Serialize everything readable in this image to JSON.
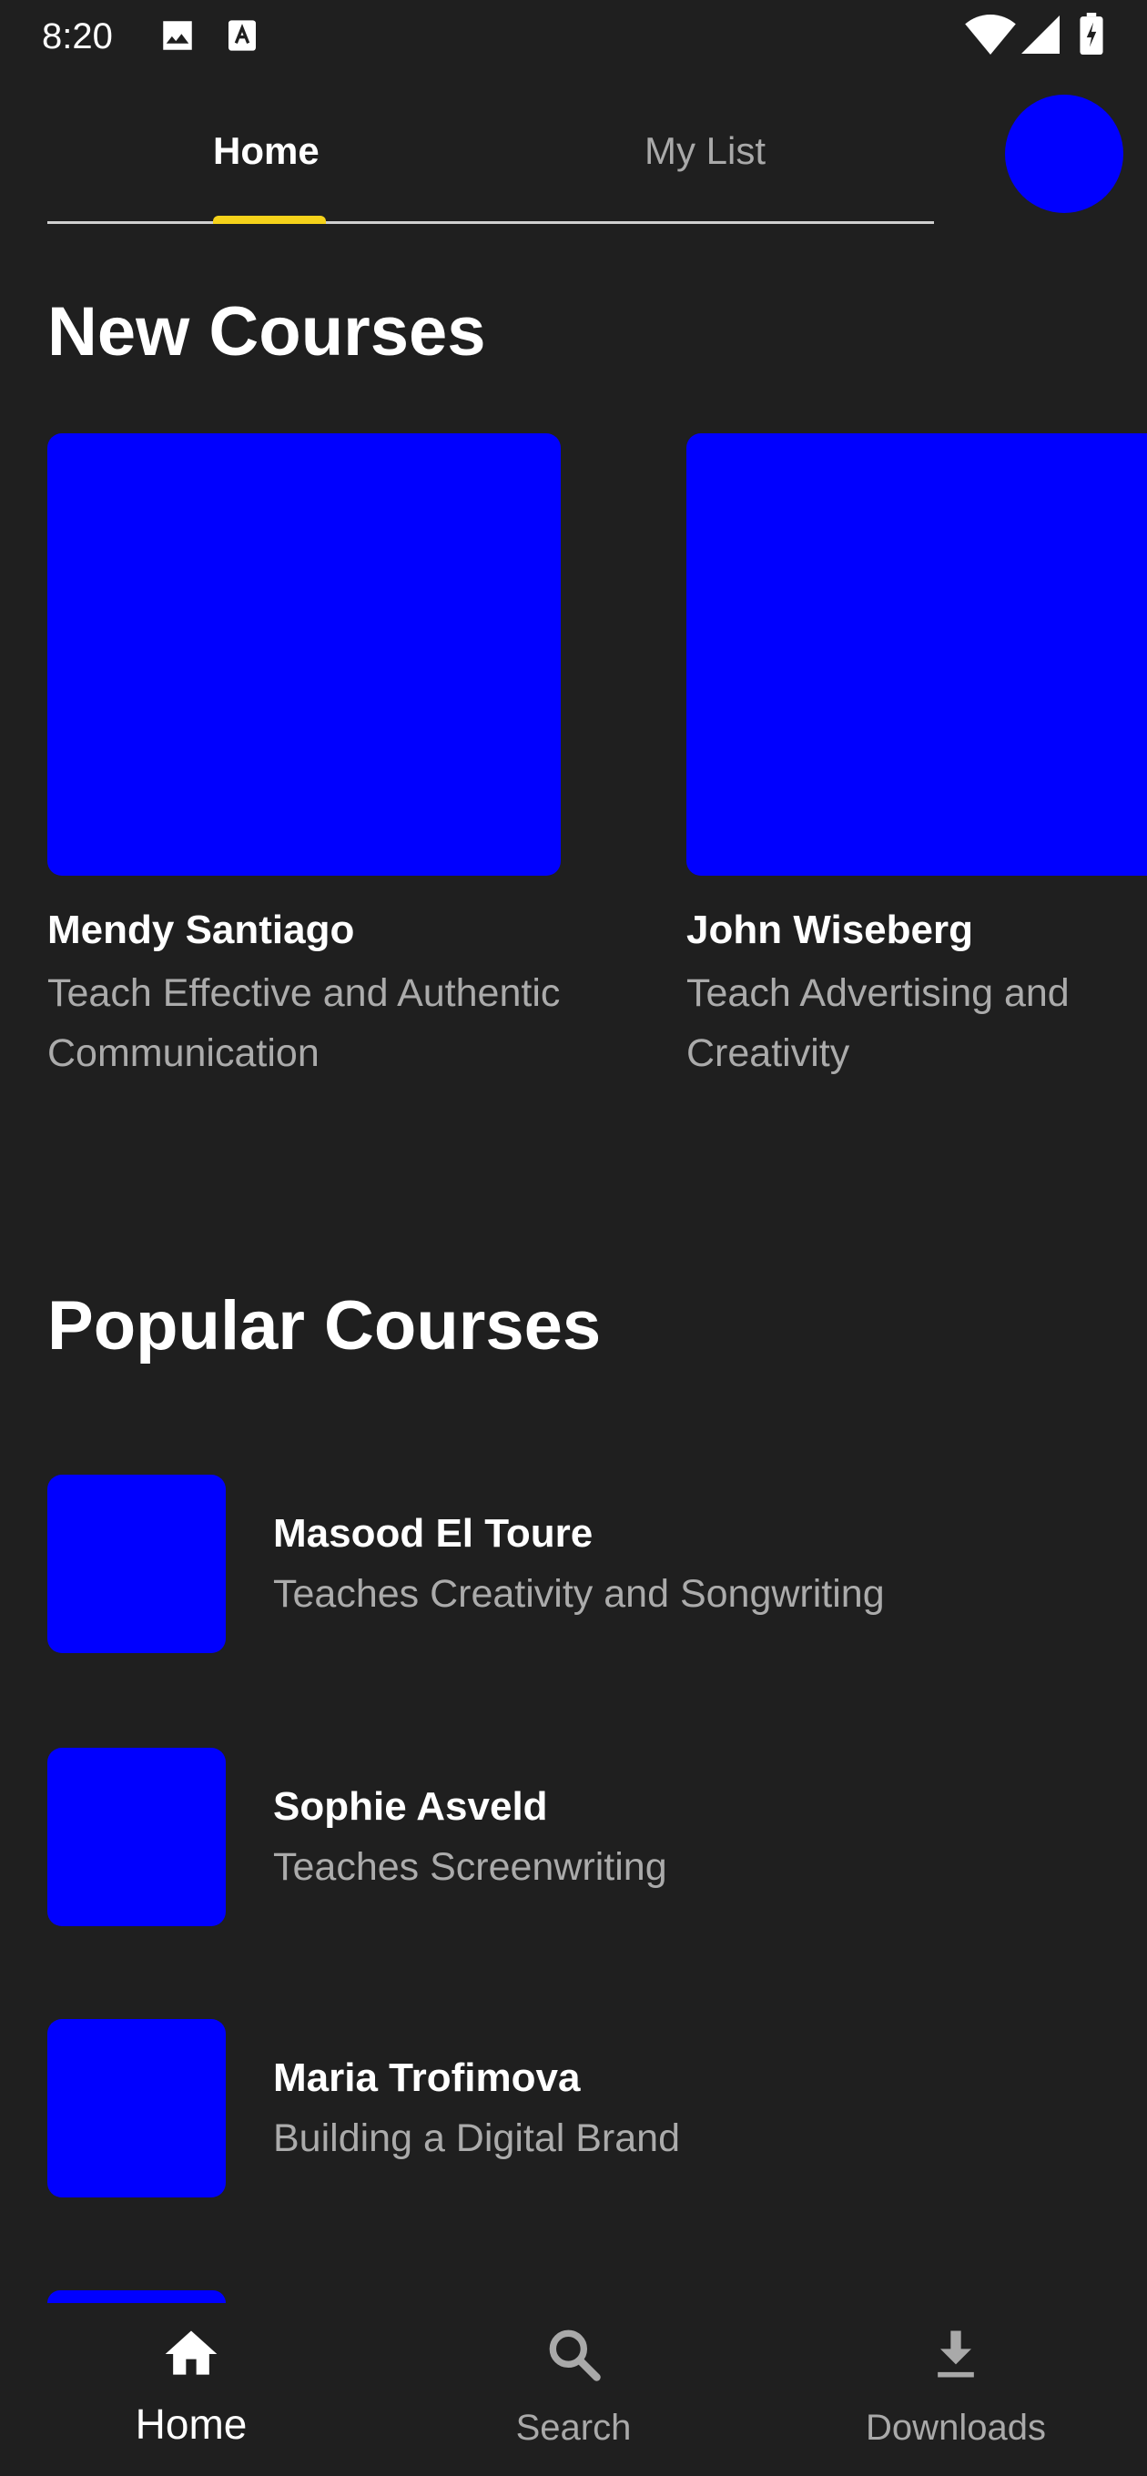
{
  "status_bar": {
    "time": "8:20",
    "left_icons": [
      "image-icon",
      "text-a-icon"
    ],
    "right_icons": [
      "wifi-icon",
      "signal-icon",
      "battery-charging-icon"
    ]
  },
  "tabs": [
    {
      "label": "Home",
      "selected": true
    },
    {
      "label": "My List",
      "selected": false
    }
  ],
  "colors": {
    "background": "#1f1f1f",
    "placeholder": "#0000ff",
    "tab_indicator": "#f5d21a",
    "secondary_text": "#ababab"
  },
  "new_courses": {
    "title": "New Courses",
    "items": [
      {
        "name": "Mendy Santiago",
        "description": "Teach Effective and Authentic Communication"
      },
      {
        "name": "John Wiseberg",
        "description": "Teach Advertising and Creativity"
      }
    ]
  },
  "popular_courses": {
    "title": "Popular Courses",
    "items": [
      {
        "name": "Masood El Toure",
        "description": "Teaches Creativity and Songwriting"
      },
      {
        "name": "Sophie Asveld",
        "description": "Teaches Screenwriting"
      },
      {
        "name": "Maria Trofimova",
        "description": "Building a Digital Brand"
      }
    ]
  },
  "bottom_nav": [
    {
      "label": "Home",
      "icon": "home-icon",
      "selected": true
    },
    {
      "label": "Search",
      "icon": "search-icon",
      "selected": false
    },
    {
      "label": "Downloads",
      "icon": "download-icon",
      "selected": false
    }
  ]
}
